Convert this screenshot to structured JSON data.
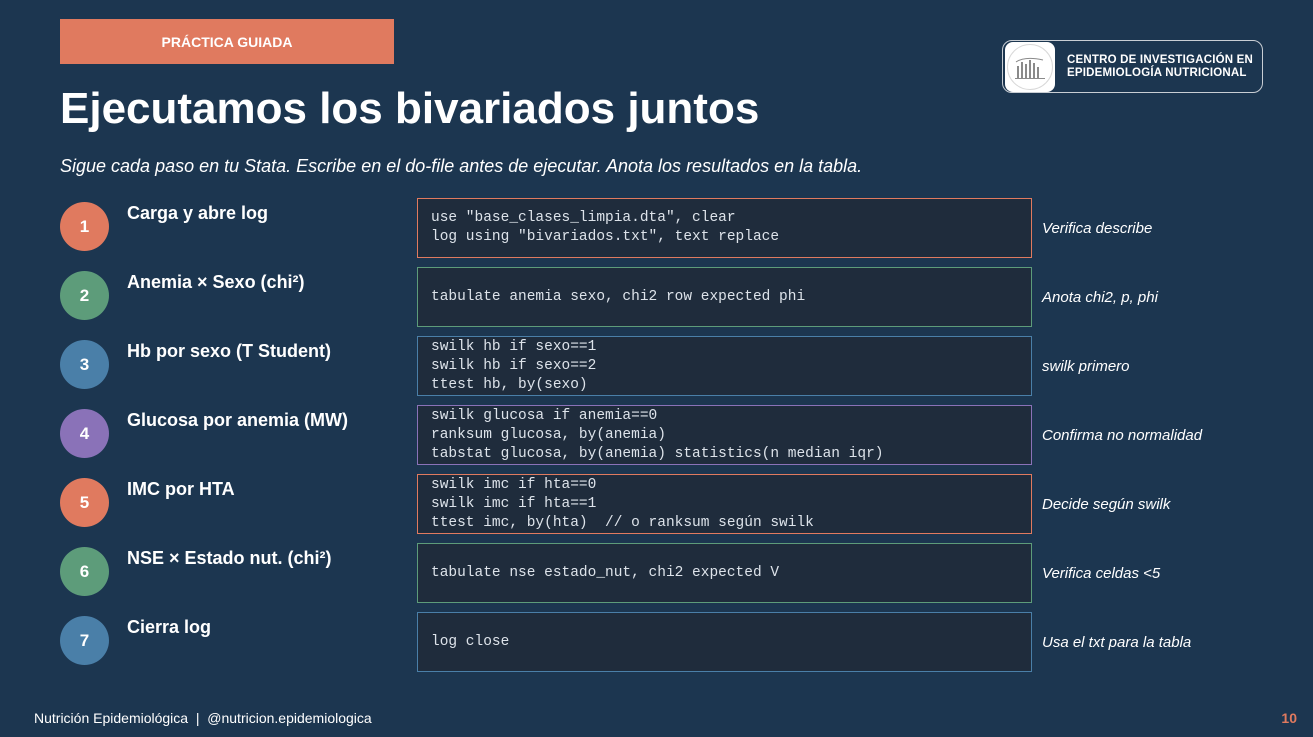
{
  "header": {
    "badge": "PRÁCTICA GUIADA",
    "title": "Ejecutamos los bivariados juntos",
    "subtitle": "Sigue cada paso en tu Stata. Escribe en el do-file antes de ejecutar. Anota los resultados en la tabla."
  },
  "logo": {
    "line1": "CENTRO DE INVESTIGACIÓN EN",
    "line2": "EPIDEMIOLOGÍA NUTRICIONAL"
  },
  "colors": {
    "background": "#1c3650",
    "orange": "#e07a5f",
    "green": "#5d9c7a",
    "blue": "#4a7fa8",
    "purple": "#8a72b8"
  },
  "steps": [
    {
      "num": "1",
      "label": "Carga y abre log",
      "color": "#e07a5f",
      "code": [
        "use \"base_clases_limpia.dta\", clear",
        "log using \"bivariados.txt\", text replace"
      ],
      "note": "Verifica describe"
    },
    {
      "num": "2",
      "label": "Anemia × Sexo (chi²)",
      "color": "#5d9c7a",
      "code": [
        "tabulate anemia sexo, chi2 row expected phi"
      ],
      "note": "Anota chi2, p, phi"
    },
    {
      "num": "3",
      "label": "Hb por sexo (T Student)",
      "color": "#4a7fa8",
      "code": [
        "swilk hb if sexo==1",
        "swilk hb if sexo==2",
        "ttest hb, by(sexo)"
      ],
      "note": "swilk primero"
    },
    {
      "num": "4",
      "label": "Glucosa por anemia (MW)",
      "color": "#8a72b8",
      "code": [
        "swilk glucosa if anemia==0",
        "ranksum glucosa, by(anemia)",
        "tabstat glucosa, by(anemia) statistics(n median iqr)"
      ],
      "note": "Confirma no normalidad"
    },
    {
      "num": "5",
      "label": "IMC por HTA",
      "color": "#e07a5f",
      "code": [
        "swilk imc if hta==0",
        "swilk imc if hta==1",
        "ttest imc, by(hta)  // o ranksum según swilk"
      ],
      "note": "Decide según swilk"
    },
    {
      "num": "6",
      "label": "NSE × Estado nut. (chi²)",
      "color": "#5d9c7a",
      "code": [
        "tabulate nse estado_nut, chi2 expected V"
      ],
      "note": "Verifica celdas <5"
    },
    {
      "num": "7",
      "label": "Cierra log",
      "color": "#4a7fa8",
      "code": [
        "log close"
      ],
      "note": "Usa el txt para la tabla"
    }
  ],
  "footer": {
    "text": "Nutrición Epidemiológica  |  @nutricion.epidemiologica",
    "page": "10"
  }
}
